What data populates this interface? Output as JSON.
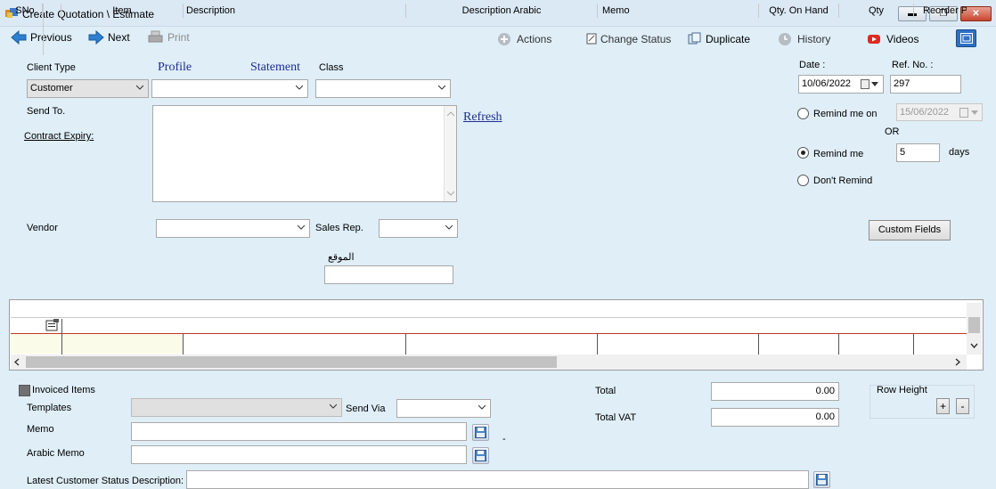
{
  "window": {
    "title": "Create Quotation \\ Estimate"
  },
  "toolbar": {
    "previous": "Previous",
    "next": "Next",
    "print": "Print",
    "actions": "Actions",
    "change_status": "Change Status",
    "duplicate": "Duplicate",
    "history": "History",
    "videos": "Videos"
  },
  "form": {
    "client_type_label": "Client Type",
    "client_type_value": "Customer",
    "profile_link": "Profile",
    "statement_link": "Statement",
    "class_label": "Class",
    "send_to_label": "Send To.",
    "contract_expiry_label": "Contract Expiry:",
    "refresh_link": "Refresh",
    "vendor_label": "Vendor",
    "sales_rep_label": "Sales Rep.",
    "location_label": "الموقع",
    "date_label": "Date :",
    "date_value": "10/06/2022",
    "ref_no_label": "Ref. No. :",
    "ref_no_value": "297",
    "remind_on_label": "Remind me on",
    "remind_on_date": "15/06/2022",
    "or_label": "OR",
    "remind_me_label": "Remind me",
    "remind_days_value": "5",
    "days_label": "days",
    "dont_remind_label": "Don't Remind",
    "custom_fields_button": "Custom Fields"
  },
  "grid": {
    "columns": [
      "SNo.",
      "Item",
      "Description",
      "Description Arabic",
      "Memo",
      "Qty. On Hand",
      "Qty",
      "Reorder P"
    ]
  },
  "footer": {
    "invoiced_items_label": "Invoiced Items",
    "templates_label": "Templates",
    "send_via_label": "Send Via",
    "memo_label": "Memo",
    "arabic_memo_label": "Arabic Memo",
    "dash": "-",
    "latest_status_label": "Latest Customer Status Description:",
    "total_label": "Total",
    "total_value": "0.00",
    "total_vat_label": "Total VAT",
    "total_vat_value": "0.00",
    "row_height_label": "Row Height",
    "plus": "+",
    "minus": "-"
  },
  "colors": {
    "background": "#dfeef7",
    "link": "#1f2d8f",
    "grid_active_row": "#c0392b"
  }
}
